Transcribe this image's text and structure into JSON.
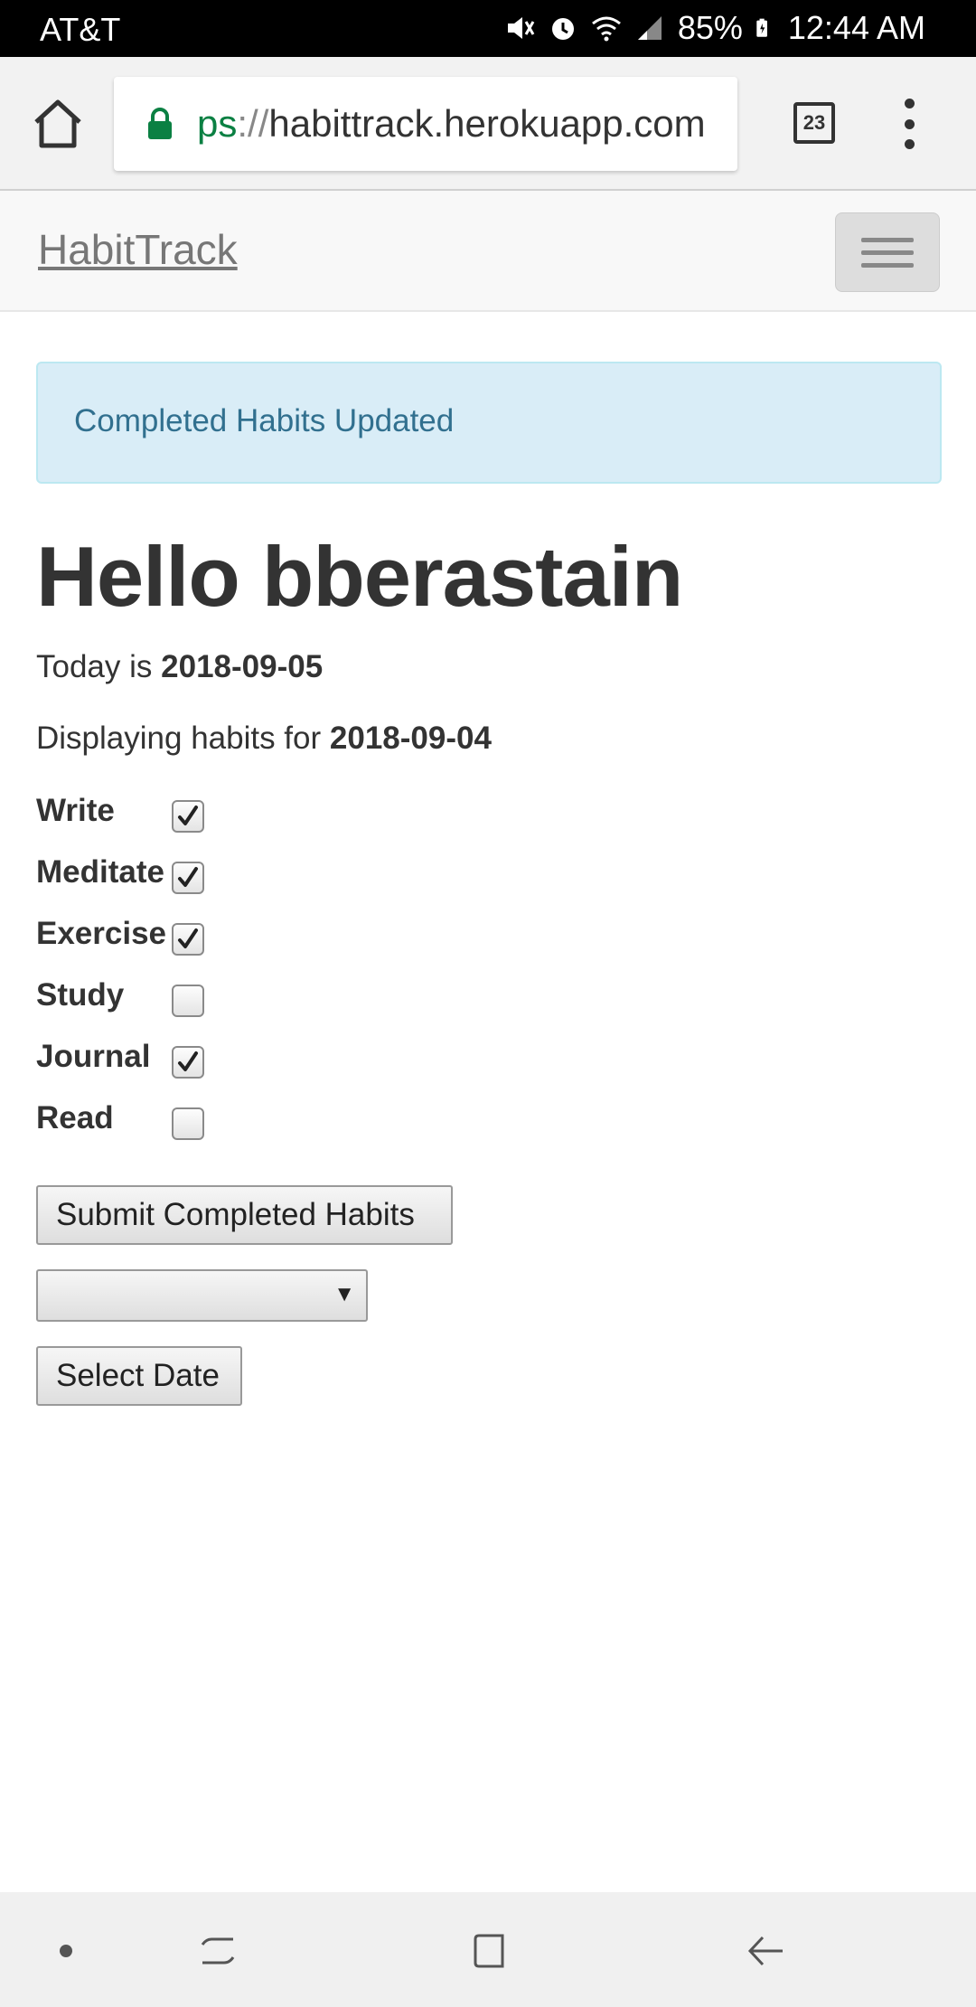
{
  "status_bar": {
    "carrier": "AT&T",
    "battery": "85%",
    "time": "12:44 AM"
  },
  "browser": {
    "url_scheme": "ps",
    "url_sep": "://",
    "url_host": "habittrack.herokuapp.com",
    "tab_count": "23"
  },
  "navbar": {
    "brand": "HabitTrack"
  },
  "alert": {
    "message": "Completed Habits Updated"
  },
  "main": {
    "greeting": "Hello bberastain",
    "today_prefix": "Today is",
    "today_date": "2018-09-05",
    "displaying_prefix": "Displaying habits for",
    "displaying_date": "2018-09-04",
    "habits": [
      {
        "label": "Write",
        "checked": true
      },
      {
        "label": "Meditate",
        "checked": true
      },
      {
        "label": "Exercise",
        "checked": true
      },
      {
        "label": "Study",
        "checked": false
      },
      {
        "label": "Journal",
        "checked": true
      },
      {
        "label": "Read",
        "checked": false
      }
    ],
    "submit_label": "Submit Completed Habits",
    "date_select_value": "",
    "select_date_label": "Select Date"
  }
}
